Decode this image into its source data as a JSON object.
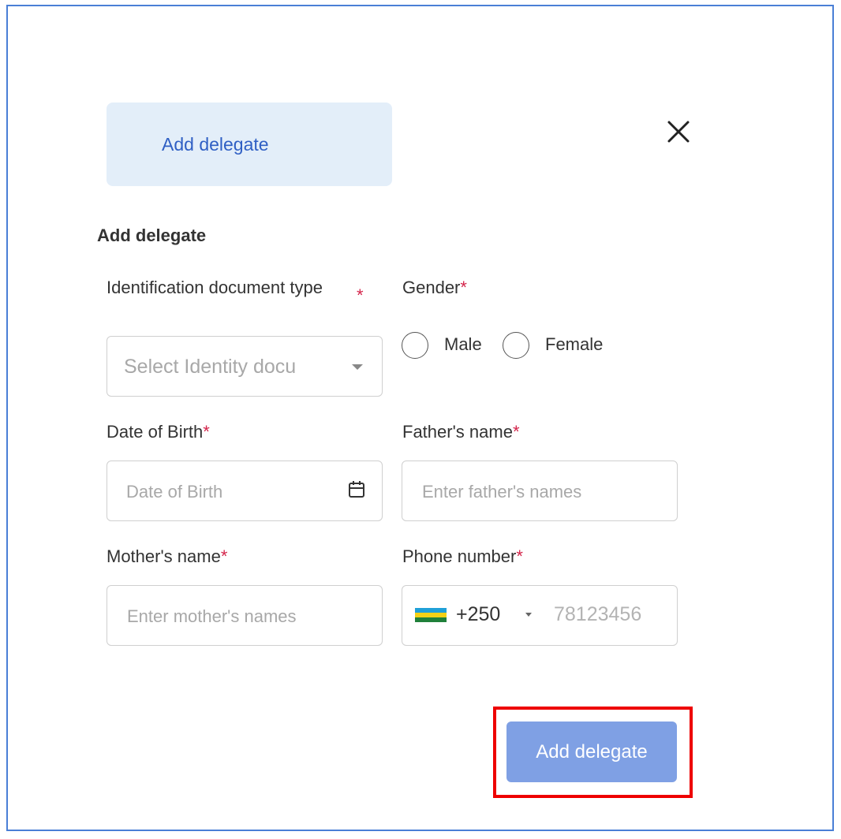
{
  "tab": {
    "label": "Add delegate"
  },
  "form": {
    "title": "Add delegate",
    "id_type": {
      "label": "Identification document type",
      "required": "*",
      "placeholder": "Select Identity docu"
    },
    "gender": {
      "label": "Gender",
      "required": "*",
      "options": [
        "Male",
        "Female"
      ]
    },
    "dob": {
      "label": "Date of Birth",
      "required": "*",
      "placeholder": "Date of Birth"
    },
    "father": {
      "label": "Father's name",
      "required": "*",
      "placeholder": "Enter father's names"
    },
    "mother": {
      "label": "Mother's name",
      "required": "*",
      "placeholder": "Enter mother's names"
    },
    "phone": {
      "label": "Phone number",
      "required": "*",
      "country_code": "+250",
      "placeholder": "78123456"
    }
  },
  "submit": {
    "label": "Add delegate"
  },
  "colors": {
    "accent": "#2f5fc4",
    "button": "#7fa0e4",
    "required": "#d4254b",
    "highlight": "#ee0000"
  },
  "icons": {
    "close": "close-icon",
    "calendar": "calendar-icon",
    "flag": "rwanda-flag-icon"
  }
}
